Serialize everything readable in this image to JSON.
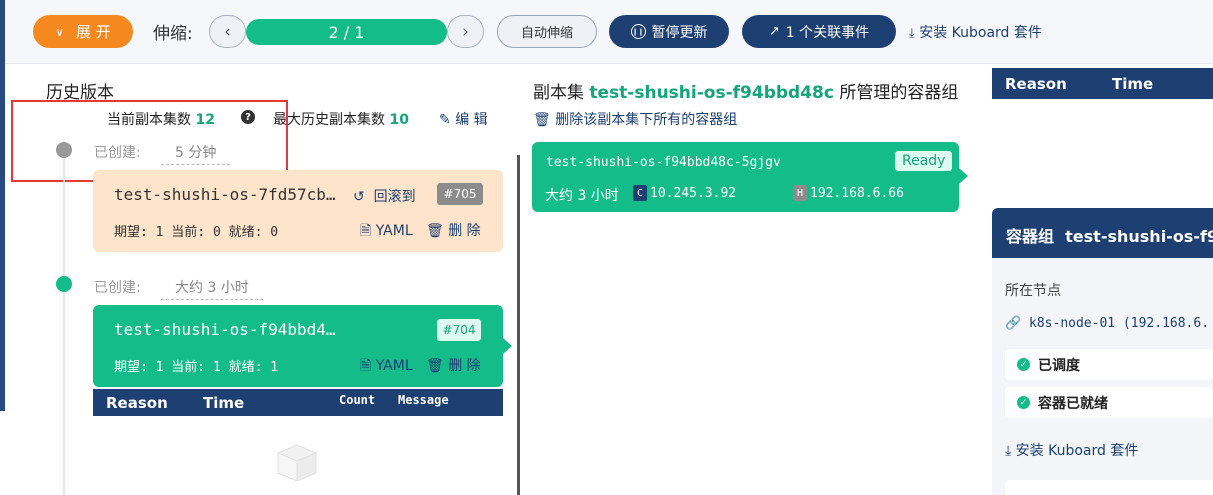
{
  "toolbar": {
    "expand_label": "展 开",
    "scale_label": "伸缩:",
    "replica_display": "2 / 1",
    "auto_scale_label": "自动伸缩",
    "pause_label": "暂停更新",
    "events_label": "1 个关联事件",
    "install_label": "安装 Kuboard 套件"
  },
  "history": {
    "title": "历史版本",
    "current_replicas_label": "当前副本集数",
    "current_replicas_value": "12",
    "help": "?",
    "max_history_label": "最大历史副本集数",
    "max_history_value": "10",
    "edit_label": "编 辑",
    "entries": [
      {
        "created_label": "已创建:",
        "age": "5 分钟",
        "name": "test-shushi-os-7fd57cb…",
        "rollback_label": "回滚到",
        "revision": "#705",
        "status": "期望: 1 当前: 0 就绪: 0",
        "yaml_label": "YAML",
        "delete_label": "删 除"
      },
      {
        "created_label": "已创建:",
        "age": "大约 3 小时",
        "name": "test-shushi-os-f94bbd4…",
        "revision": "#704",
        "status": "期望: 1 当前: 1 就绪: 1",
        "yaml_label": "YAML",
        "delete_label": "删 除"
      }
    ],
    "events_table": {
      "reason": "Reason",
      "time": "Time",
      "count": "Count",
      "message": "Message"
    }
  },
  "replicaset": {
    "title_prefix": "副本集",
    "name": "test-shushi-os-f94bbd48c",
    "title_suffix": "所管理的容器组",
    "delete_all_label": "删除该副本集下所有的容器组",
    "pod": {
      "name": "test-shushi-os-f94bbd48c-5gjgv",
      "status": "Ready",
      "age": "大约 3 小时",
      "pod_ip_tag": "C",
      "pod_ip": "10.245.3.92",
      "host_ip_tag": "H",
      "host_ip": "192.168.6.66"
    }
  },
  "right_panel": {
    "table": {
      "reason": "Reason",
      "time": "Time"
    },
    "title_prefix": "容器组",
    "title_name": "test-shushi-os-f9",
    "node_label": "所在节点",
    "node_value": "k8s-node-01 (192.168.6.",
    "scheduled_label": "已调度",
    "ready_label": "容器已就绪",
    "install_label": "安装 Kuboard 套件"
  }
}
